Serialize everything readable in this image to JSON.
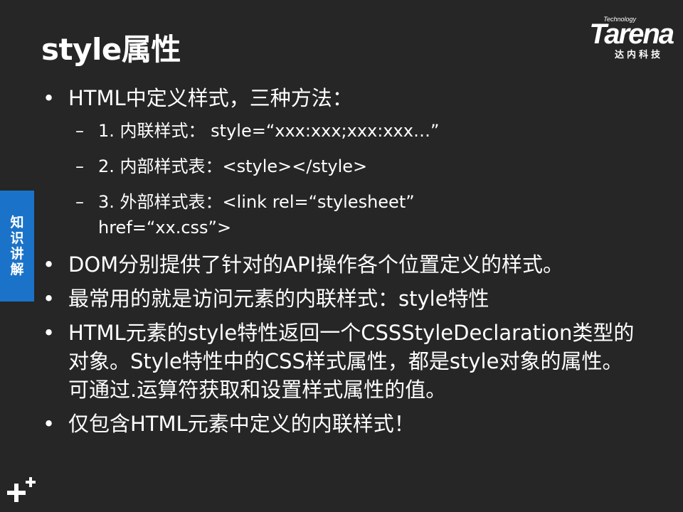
{
  "slide": {
    "title": "style属性",
    "logo": {
      "small": "Technology",
      "word": "Tarena",
      "cn": "达内科技"
    },
    "side_tab": [
      "知",
      "识",
      "讲",
      "解"
    ],
    "bullets": [
      {
        "text": "HTML中定义样式，三种方法："
      },
      {
        "text": "DOM分别提供了针对的API操作各个位置定义的样式。"
      },
      {
        "text": "最常用的就是访问元素的内联样式：style特性"
      },
      {
        "text": "HTML元素的style特性返回一个CSSStyleDeclaration类型的对象。Style特性中的CSS样式属性，都是style对象的属性。可通过.运算符获取和设置样式属性的值。"
      },
      {
        "text": "仅包含HTML元素中定义的内联样式！"
      }
    ],
    "sub_items": [
      "1. 内联样式： style=“xxx:xxx;xxx:xxx…”",
      "2. 内部样式表：<style></style>",
      "3. 外部样式表：<link rel=“stylesheet” href=“xx.css”>"
    ],
    "dash": "–"
  },
  "colors": {
    "background": "#262626",
    "text": "#ffffff",
    "accent": "#1a73c9"
  }
}
